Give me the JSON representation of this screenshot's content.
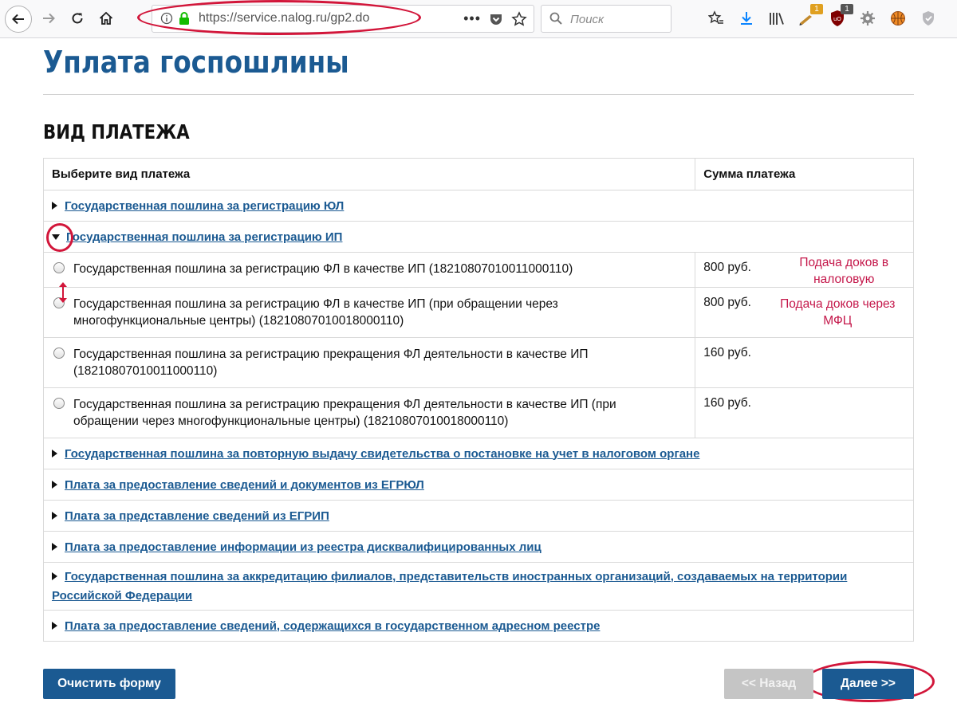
{
  "browser": {
    "url": "https://service.nalog.ru/gp2.do",
    "search_placeholder": "Поиск",
    "badge_a": "1",
    "badge_b": "1"
  },
  "page": {
    "title": "Уплата госпошлины",
    "section_title": "ВИД ПЛАТЕЖА"
  },
  "table": {
    "col_type": "Выберите вид платежа",
    "col_sum": "Сумма платежа",
    "group_ul": "Государственная пошлина за регистрацию ЮЛ",
    "group_ip": "Государственная пошлина за регистрацию ИП",
    "options": [
      {
        "text": "Государственная пошлина за регистрацию ФЛ в качестве ИП (18210807010011000110)",
        "sum": "800 руб."
      },
      {
        "text": "Государственная пошлина за регистрацию ФЛ в качестве ИП (при обращении через многофункциональные центры) (18210807010018000110)",
        "sum": "800 руб."
      },
      {
        "text": "Государственная пошлина за регистрацию прекращения ФЛ деятельности в качестве ИП (18210807010011000110)",
        "sum": "160 руб."
      },
      {
        "text": "Государственная пошлина за регистрацию прекращения ФЛ деятельности в качестве ИП (при обращении через многофункциональные центры) (18210807010018000110)",
        "sum": "160 руб."
      }
    ],
    "groups_after": [
      "Государственная пошлина за повторную выдачу свидетельства о постановке на учет в налоговом органе",
      "Плата за предоставление сведений и документов из ЕГРЮЛ",
      "Плата за представление сведений из ЕГРИП",
      "Плата за предоставление информации из реестра дисквалифицированных лиц",
      "Государственная пошлина за аккредитацию филиалов, представительств иностранных организаций, создаваемых на территории Российской Федерации",
      "Плата за предоставление сведений, содержащихся в государственном адресном реестре"
    ]
  },
  "annotations": {
    "note1_line1": "Подача доков в",
    "note1_line2": "налоговую",
    "note2_line1": "Подача доков через",
    "note2_line2": "МФЦ"
  },
  "buttons": {
    "clear": "Очистить форму",
    "back": "<< Назад",
    "next": "Далее >>"
  },
  "colors": {
    "brand_blue": "#1b5a92",
    "annotation_red": "#d2163a",
    "annotation_text": "#c4174a"
  }
}
